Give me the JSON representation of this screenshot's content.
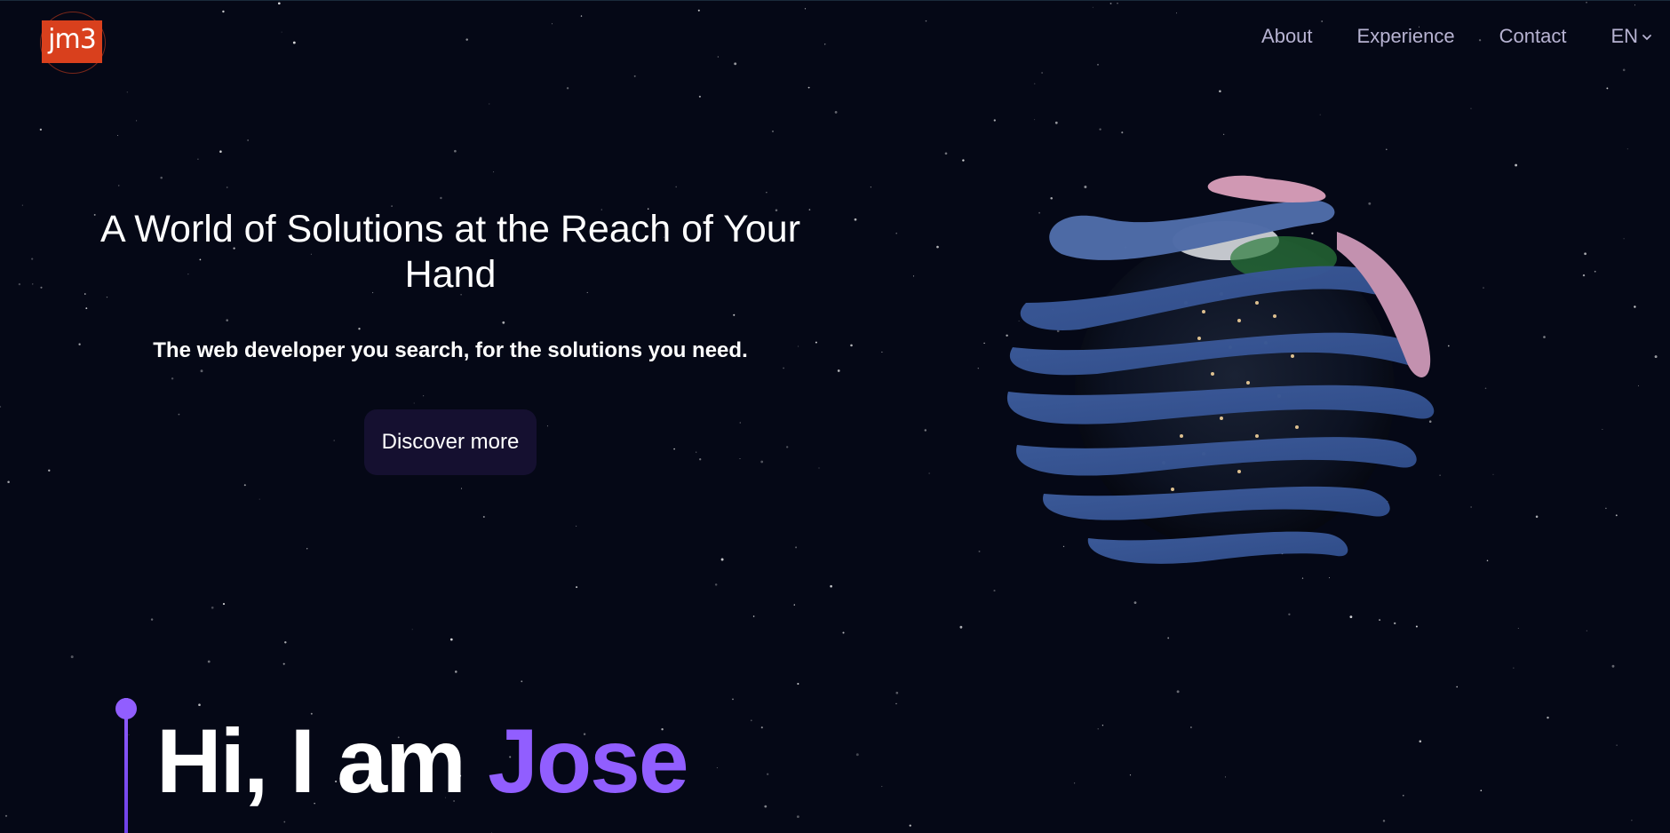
{
  "brand": {
    "logo_text": "jm3",
    "logo_color": "#d9401d"
  },
  "nav": {
    "items": [
      {
        "label": "About"
      },
      {
        "label": "Experience"
      },
      {
        "label": "Contact"
      }
    ],
    "language": {
      "selected": "EN",
      "icon": "chevron-down-icon"
    }
  },
  "hero": {
    "title": "A World of Solutions at the Reach of Your Hand",
    "subtitle": "The web developer you search, for the solutions you need.",
    "cta_label": "Discover more"
  },
  "intro": {
    "greeting": "Hi, I am ",
    "name": "Jose",
    "accent_color": "#915eff"
  },
  "theme": {
    "background": "#050816",
    "button_bg": "#151030",
    "nav_text": "#b7b3d2"
  },
  "visual": {
    "globe": "earth-globe-with-blue-ribbons"
  }
}
